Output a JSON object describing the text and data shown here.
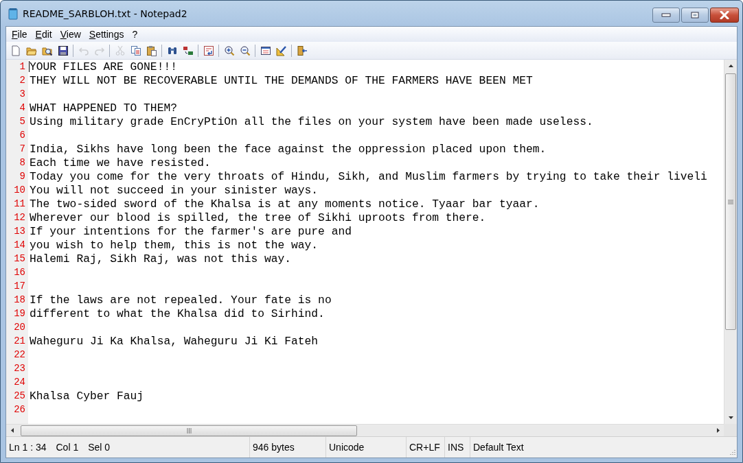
{
  "window": {
    "title": "README_SARBLOH.txt - Notepad2"
  },
  "menu": [
    {
      "label": "File"
    },
    {
      "label": "Edit"
    },
    {
      "label": "View"
    },
    {
      "label": "Settings"
    },
    {
      "label": "?"
    }
  ],
  "toolbar": [
    {
      "kind": "new",
      "disabled": false
    },
    {
      "kind": "open",
      "disabled": false
    },
    {
      "kind": "browse",
      "disabled": false
    },
    {
      "kind": "save",
      "disabled": false
    },
    {
      "kind": "sep"
    },
    {
      "kind": "undo",
      "disabled": true
    },
    {
      "kind": "redo",
      "disabled": true
    },
    {
      "kind": "sep"
    },
    {
      "kind": "cut",
      "disabled": true
    },
    {
      "kind": "copy",
      "disabled": false
    },
    {
      "kind": "paste",
      "disabled": false
    },
    {
      "kind": "sep"
    },
    {
      "kind": "find",
      "disabled": false
    },
    {
      "kind": "replace",
      "disabled": false
    },
    {
      "kind": "sep"
    },
    {
      "kind": "wrap",
      "disabled": false
    },
    {
      "kind": "sep"
    },
    {
      "kind": "zoomin",
      "disabled": false
    },
    {
      "kind": "zoomout",
      "disabled": false
    },
    {
      "kind": "sep"
    },
    {
      "kind": "scheme",
      "disabled": false
    },
    {
      "kind": "customize",
      "disabled": false
    },
    {
      "kind": "sep"
    },
    {
      "kind": "exit",
      "disabled": false
    }
  ],
  "lines": [
    {
      "number": "1",
      "text": "YOUR FILES ARE GONE!!!"
    },
    {
      "number": "2",
      "text": "THEY WILL NOT BE RECOVERABLE UNTIL THE DEMANDS OF THE FARMERS HAVE BEEN MET"
    },
    {
      "number": "3"
    },
    {
      "number": "4",
      "text": "WHAT HAPPENED TO THEM?"
    },
    {
      "number": "5",
      "text": "Using military grade EnCryPtiOn all the files on your system have been made useless."
    },
    {
      "number": "6"
    },
    {
      "number": "7",
      "text": "India, Sikhs have long been the face against the oppression placed upon them."
    },
    {
      "number": "8",
      "text": "Each time we have resisted."
    },
    {
      "number": "9",
      "text": "Today you come for the very throats of Hindu, Sikh, and Muslim farmers by trying to take their liveli"
    },
    {
      "number": "10",
      "text": "You will not succeed in your sinister ways."
    },
    {
      "number": "11",
      "text": "The two-sided sword of the Khalsa is at any moments notice. Tyaar bar tyaar."
    },
    {
      "number": "12",
      "text": "Wherever our blood is spilled, the tree of Sikhi uproots from there."
    },
    {
      "number": "13",
      "text": "If your intentions for the farmer's are pure and"
    },
    {
      "number": "14",
      "text": "you wish to help them, this is not the way."
    },
    {
      "number": "15",
      "text": "Halemi Raj, Sikh Raj, was not this way."
    },
    {
      "number": "16"
    },
    {
      "number": "17"
    },
    {
      "number": "18",
      "text": "If the laws are not repealed. Your fate is no"
    },
    {
      "number": "19",
      "text": "different to what the Khalsa did to Sirhind."
    },
    {
      "number": "20"
    },
    {
      "number": "21",
      "text": "Waheguru Ji Ka Khalsa, Waheguru Ji Ki Fateh"
    },
    {
      "number": "22"
    },
    {
      "number": "23"
    },
    {
      "number": "24"
    },
    {
      "number": "25",
      "text": "Khalsa Cyber Fauj"
    },
    {
      "number": "26"
    }
  ],
  "status_bar": {
    "position": [
      "Ln 1 : 34",
      "Col 1",
      "Sel 0"
    ],
    "size": "946 bytes",
    "encoding": "Unicode",
    "line_endings": "CR+LF",
    "mode": "INS",
    "scheme": "Default Text"
  }
}
